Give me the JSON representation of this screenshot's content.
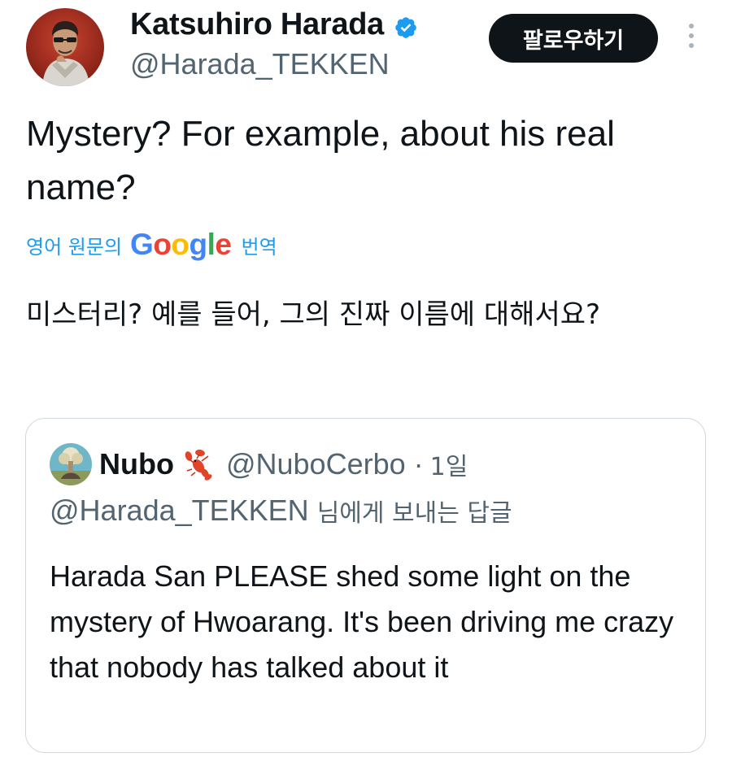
{
  "author": {
    "display_name": "Katsuhiro Harada",
    "handle": "@Harada_TEKKEN",
    "verified": true
  },
  "follow_button": {
    "label": "팔로우하기"
  },
  "more_menu": {
    "icon": "more-vertical-icon"
  },
  "tweet": {
    "text": "Mystery? For example, about his real name?"
  },
  "translation": {
    "prefix": "영어 원문의",
    "provider": "Google",
    "suffix": "번역",
    "text": "미스터리? 예를 들어, 그의 진짜 이름에 대해서요?"
  },
  "quoted_tweet": {
    "display_name": "Nubo",
    "emoji_icon": "lobster-icon",
    "handle": "@NuboCerbo",
    "separator": "·",
    "time": "1일",
    "reply_to_handle": "@Harada_TEKKEN",
    "reply_to_suffix": "님에게 보내는 답글",
    "text": "Harada San PLEASE shed some light on the mystery of Hwoarang. It's been driving me crazy that nobody has talked about it"
  },
  "colors": {
    "text_primary": "#0f1419",
    "text_secondary": "#536471",
    "link_blue": "#1d9bf0",
    "verified_blue": "#1d9bf0",
    "button_bg": "#0f1419",
    "card_border": "#cfd9de"
  }
}
